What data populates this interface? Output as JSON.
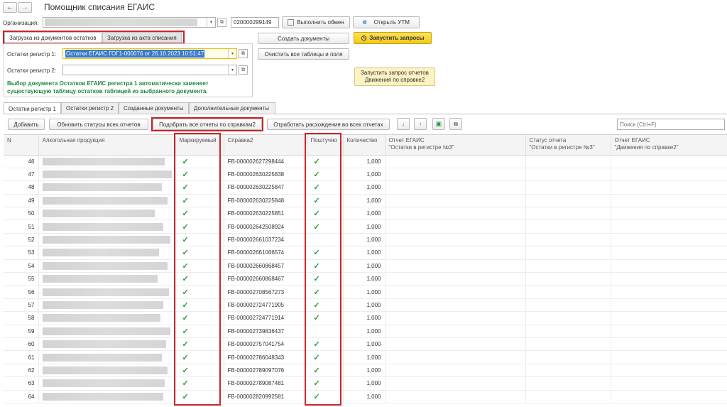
{
  "window": {
    "title": "Помощник списания ЕГАИС",
    "back_icon": "arrow-left-icon",
    "forward_icon": "arrow-right-icon"
  },
  "org": {
    "label": "Организация:",
    "code": "020000299149",
    "exchange_label": "Выполнить обмен",
    "utm_label": "Открыть УТМ"
  },
  "actions": {
    "create_docs": "Создать документы",
    "run_queries": "Запустить запросы",
    "clear": "Очистить все таблицы и поля",
    "run_reports_line1": "Запустить запрос отчетов",
    "run_reports_line2": "Движения по справке2"
  },
  "upper_tabs": [
    "Загрузка из документов остатков",
    "Загрузка из акта списания"
  ],
  "register1": {
    "label": "Остатки регистр 1:",
    "value": "Остатки ЕГАИС ГОГ1-000076 от 26.10.2023 10:51:47"
  },
  "register2": {
    "label": "Остатки регистр 2:",
    "value": ""
  },
  "hint": "Выбор документа Остатков ЕГАИС регистра 1 автоматически заменяет существующую таблицу остатков таблицей из выбранного документа.",
  "lower_tabs": [
    "Остатки регистр 1",
    "Остатки регистр 2",
    "Созданные документы",
    "Дополнительные документы"
  ],
  "toolbar": {
    "add": "Добавить",
    "update_statuses": "Обновить статусы всех отчетов",
    "pick_reports": "Подобрать все отчеты по справкам2",
    "process_diff": "Отработать расхождения во всех отчетах",
    "search_placeholder": "Поиск (Ctrl+F)"
  },
  "columns": {
    "n": "N",
    "product": "Алкогольная продукция",
    "marked": "Маркируемый",
    "ref2": "Справка2",
    "piece": "Поштучно",
    "qty": "Количество",
    "rep1_l1": "Отчет ЕГАИС",
    "rep1_l2": "\"Остатки в регистре №3\"",
    "status_l1": "Статус отчета",
    "status_l2": "\"Остатки в регистре №3\"",
    "rep2_l1": "Отчет ЕГАИС",
    "rep2_l2": "\"Движения по справке2\""
  },
  "check_glyph": "✓",
  "rows": [
    {
      "n": "46",
      "marked": true,
      "ref2": "FB-000002627298444",
      "piece": true,
      "qty": "1,000"
    },
    {
      "n": "47",
      "marked": true,
      "ref2": "FB-000002630225838",
      "piece": true,
      "qty": "1,000"
    },
    {
      "n": "48",
      "marked": true,
      "ref2": "FB-000002630225847",
      "piece": true,
      "qty": "1,000"
    },
    {
      "n": "49",
      "marked": true,
      "ref2": "FB-000002630225848",
      "piece": true,
      "qty": "1,000"
    },
    {
      "n": "50",
      "marked": true,
      "ref2": "FB-000002630225851",
      "piece": true,
      "qty": "1,000"
    },
    {
      "n": "51",
      "marked": true,
      "ref2": "FB-000002642508924",
      "piece": true,
      "qty": "1,000"
    },
    {
      "n": "52",
      "marked": true,
      "ref2": "FB-000002661037234",
      "piece": false,
      "qty": "1,000"
    },
    {
      "n": "53",
      "marked": true,
      "ref2": "FB-000002661066574",
      "piece": true,
      "qty": "1,000"
    },
    {
      "n": "54",
      "marked": true,
      "ref2": "FB-000002660868457",
      "piece": true,
      "qty": "1,000"
    },
    {
      "n": "55",
      "marked": true,
      "ref2": "FB-000002660868467",
      "piece": true,
      "qty": "1,000"
    },
    {
      "n": "56",
      "marked": true,
      "ref2": "FB-000002708567273",
      "piece": true,
      "qty": "1,000"
    },
    {
      "n": "57",
      "marked": true,
      "ref2": "FB-000002724771905",
      "piece": true,
      "qty": "1,000"
    },
    {
      "n": "58",
      "marked": true,
      "ref2": "FB-000002724771914",
      "piece": true,
      "qty": "1,000"
    },
    {
      "n": "59",
      "marked": true,
      "ref2": "FB-000002739836437",
      "piece": false,
      "qty": "1,000"
    },
    {
      "n": "60",
      "marked": true,
      "ref2": "FB-000002757041754",
      "piece": true,
      "qty": "1,000"
    },
    {
      "n": "61",
      "marked": true,
      "ref2": "FB-000002786048343",
      "piece": true,
      "qty": "1,000"
    },
    {
      "n": "62",
      "marked": true,
      "ref2": "FB-000002789097076",
      "piece": true,
      "qty": "1,000"
    },
    {
      "n": "63",
      "marked": true,
      "ref2": "FB-000002789087481",
      "piece": true,
      "qty": "1,000"
    },
    {
      "n": "64",
      "marked": true,
      "ref2": "FB-000002820992581",
      "piece": true,
      "qty": "1,000"
    }
  ]
}
